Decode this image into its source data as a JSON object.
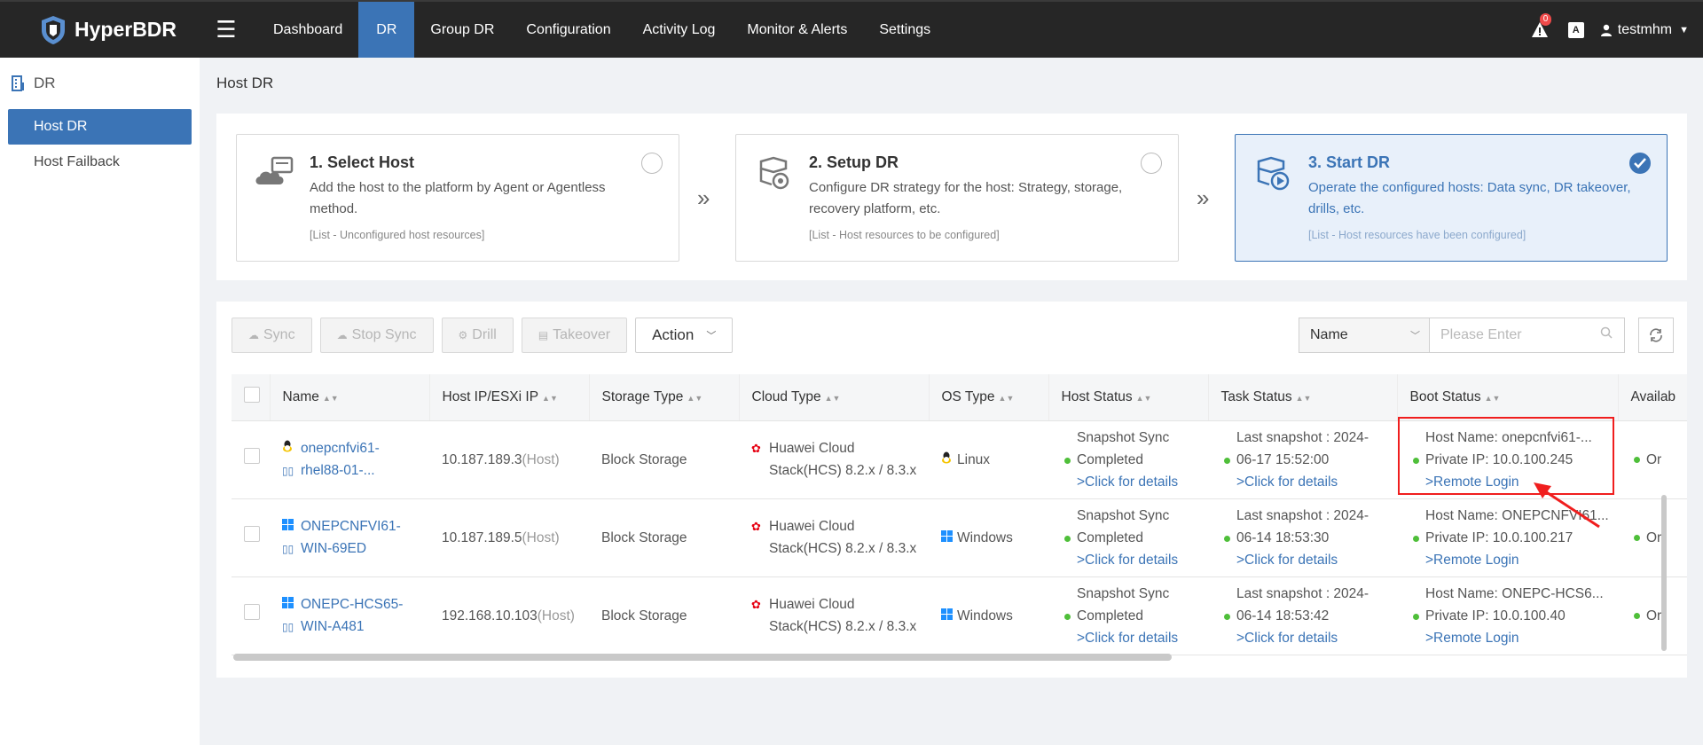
{
  "app": {
    "name": "HyperBDR"
  },
  "nav": {
    "menu_icon": "hamburger-icon",
    "items": [
      {
        "label": "Dashboard"
      },
      {
        "label": "DR",
        "active": true
      },
      {
        "label": "Group DR"
      },
      {
        "label": "Configuration"
      },
      {
        "label": "Activity Log"
      },
      {
        "label": "Monitor & Alerts"
      },
      {
        "label": "Settings"
      }
    ]
  },
  "topright": {
    "alert_count": "0",
    "lang_icon": "A",
    "username": "testmhm"
  },
  "sidebar": {
    "title": "DR",
    "items": [
      {
        "label": "Host DR",
        "active": true
      },
      {
        "label": "Host Failback"
      }
    ]
  },
  "page": {
    "title": "Host DR"
  },
  "steps": [
    {
      "title": "1. Select Host",
      "desc": "Add the host to the platform by Agent or Agentless method.",
      "note": "[List - Unconfigured host resources]",
      "checked": false
    },
    {
      "title": "2. Setup DR",
      "desc": "Configure DR strategy for the host: Strategy, storage, recovery platform, etc.",
      "note": "[List - Host resources to be configured]",
      "checked": false
    },
    {
      "title": "3. Start DR",
      "desc": "Operate the configured hosts: Data sync, DR takeover, drills, etc.",
      "note": "[List - Host resources have been configured]",
      "checked": true
    }
  ],
  "toolbar": {
    "sync": "Sync",
    "stop_sync": "Stop Sync",
    "drill": "Drill",
    "takeover": "Takeover",
    "action": "Action"
  },
  "search": {
    "field": "Name",
    "placeholder": "Please Enter"
  },
  "table": {
    "columns": [
      "Name",
      "Host IP/ESXi IP",
      "Storage Type",
      "Cloud Type",
      "OS Type",
      "Host Status",
      "Task Status",
      "Boot Status",
      "Availab"
    ],
    "rows": [
      {
        "name_line1": "onepcnfvi61-",
        "name_line2": "rhel88-01-...",
        "os_icon": "linux-icon",
        "ip": "10.187.189.3",
        "ip_suffix": "(Host)",
        "storage": "Block Storage",
        "cloud_line1": "Huawei Cloud",
        "cloud_line2": "Stack(HCS) 8.2.x / 8.3.x",
        "os": "Linux",
        "host_status_line1": "Snapshot Sync",
        "host_status_line2": "Completed",
        "host_status_link": ">Click for details",
        "task_line1": "Last snapshot : 2024-",
        "task_line2": "06-17 15:52:00",
        "task_link": ">Click for details",
        "boot_host": "Host Name: onepcnfvi61-...",
        "boot_ip": "Private IP: 10.0.100.245",
        "boot_link": ">Remote Login",
        "avail": "Or"
      },
      {
        "name_line1": "ONEPCNFVI61-",
        "name_line2": "WIN-69ED",
        "os_icon": "windows-icon",
        "ip": "10.187.189.5",
        "ip_suffix": "(Host)",
        "storage": "Block Storage",
        "cloud_line1": "Huawei Cloud",
        "cloud_line2": "Stack(HCS) 8.2.x / 8.3.x",
        "os": "Windows",
        "host_status_line1": "Snapshot Sync",
        "host_status_line2": "Completed",
        "host_status_link": ">Click for details",
        "task_line1": "Last snapshot : 2024-",
        "task_line2": "06-14 18:53:30",
        "task_link": ">Click for details",
        "boot_host": "Host Name: ONEPCNFVI61...",
        "boot_ip": "Private IP: 10.0.100.217",
        "boot_link": ">Remote Login",
        "avail": "Or"
      },
      {
        "name_line1": "ONEPC-HCS65-",
        "name_line2": "WIN-A481",
        "os_icon": "windows-icon",
        "ip": "192.168.10.103",
        "ip_suffix": "(Host)",
        "storage": "Block Storage",
        "cloud_line1": "Huawei Cloud",
        "cloud_line2": "Stack(HCS) 8.2.x / 8.3.x",
        "os": "Windows",
        "host_status_line1": "Snapshot Sync",
        "host_status_line2": "Completed",
        "host_status_link": ">Click for details",
        "task_line1": "Last snapshot : 2024-",
        "task_line2": "06-14 18:53:42",
        "task_link": ">Click for details",
        "boot_host": "Host Name: ONEPC-HCS6...",
        "boot_ip": "Private IP: 10.0.100.40",
        "boot_link": ">Remote Login",
        "avail": "Or"
      }
    ]
  },
  "colors": {
    "primary": "#3b74b6",
    "topbar": "#262626",
    "success_dot": "#4fbf3a",
    "highlight": "#f01e1e",
    "huawei": "#e60012"
  }
}
